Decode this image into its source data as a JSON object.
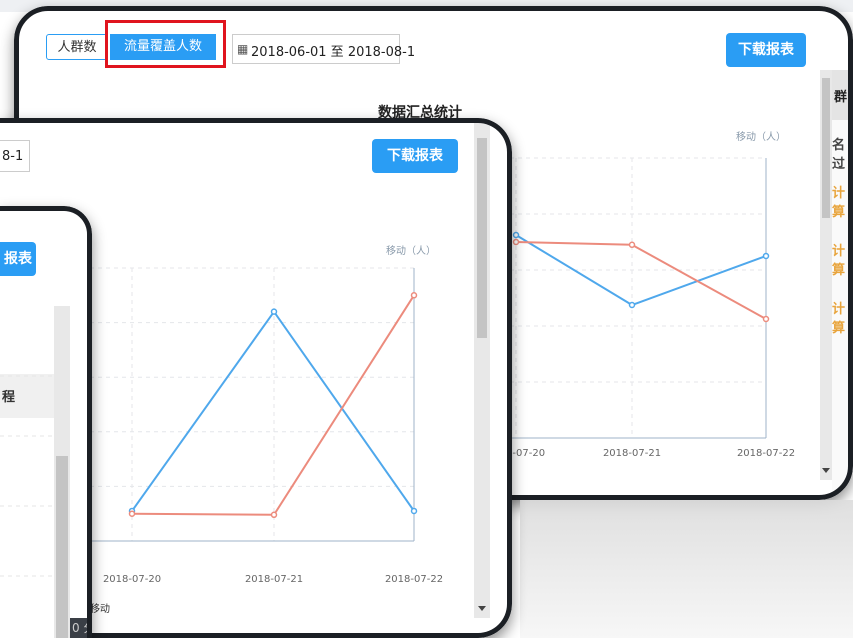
{
  "toolbar": {
    "tab_people": "人群数",
    "tab_flow": "流量覆盖人数",
    "date_range": "2018-06-01 至 2018-08-1",
    "date_range_partial": "8-1",
    "download_label": "下载报表",
    "download_partial": "报表"
  },
  "chart_title": "数据汇总统计",
  "chart_title_partial": "统计",
  "legend_label": "移动（人）",
  "side_labels": {
    "crowd": "群",
    "ranked": "名过",
    "calc": "计算"
  },
  "bottom_text": "0 分析",
  "bottom_legend_partial": "移动",
  "colors": {
    "accent": "#2a9df4",
    "series_blue": "#4fa8ec",
    "series_red": "#ec8b7d",
    "highlight_box": "#e0141e"
  },
  "chart_data": [
    {
      "type": "line",
      "title": "数据汇总统计",
      "x": [
        "2018-07-20",
        "2018-07-21",
        "2018-07-22"
      ],
      "series": [
        {
          "name": "",
          "values": [
            145,
            95,
            130
          ],
          "color": "#4fa8ec"
        },
        {
          "name": "",
          "values": [
            140,
            138,
            85
          ],
          "color": "#ec8b7d"
        }
      ],
      "ylim": [
        0,
        200
      ],
      "grid": true
    },
    {
      "type": "line",
      "title": "数据汇总统计",
      "x": [
        "2018-07-20",
        "2018-07-21",
        "2018-07-22"
      ],
      "series": [
        {
          "name": "",
          "values": [
            55,
            420,
            55
          ],
          "color": "#4fa8ec"
        },
        {
          "name": "",
          "values": [
            50,
            48,
            450
          ],
          "color": "#ec8b7d"
        }
      ],
      "ylim": [
        0,
        500
      ],
      "grid": true
    }
  ]
}
